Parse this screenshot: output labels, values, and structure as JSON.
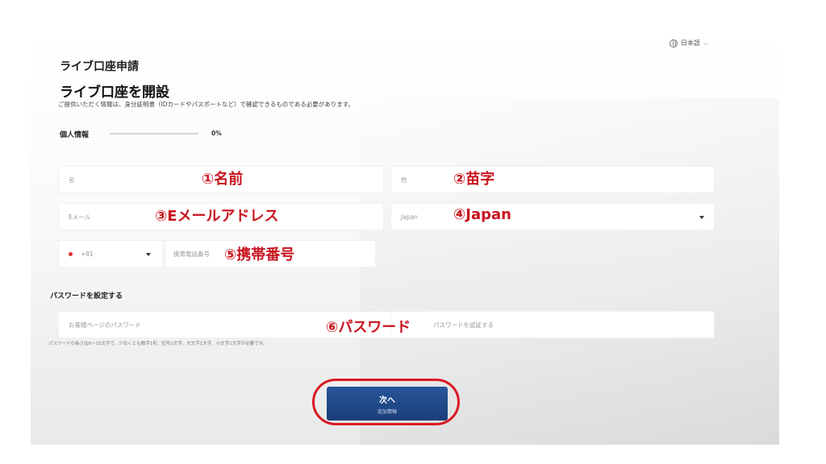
{
  "header": {
    "language": "日本語",
    "breadcrumb": "ライブ口座申請",
    "title": "ライブ口座を開設",
    "description": "ご提供いただく情報は、身分証明書（IDカードやパスポートなど）で確認できるものである必要があります。"
  },
  "personal": {
    "section_title": "個人情報",
    "progress_percent": "0%",
    "progress_value": 0
  },
  "fields": {
    "first_name": {
      "placeholder": "名",
      "annotation": "①名前"
    },
    "last_name": {
      "placeholder": "姓",
      "annotation": "②苗字"
    },
    "email": {
      "placeholder": "Eメール",
      "annotation": "③Eメールアドレス"
    },
    "country": {
      "value": "Japan",
      "annotation": "④Japan"
    },
    "phone_code": {
      "value": "+81"
    },
    "phone": {
      "placeholder": "携帯電話番号",
      "annotation": "⑤携帯番号"
    }
  },
  "password": {
    "section_title": "パスワードを設定する",
    "placeholder": "お客様ページのパスワード",
    "confirm_placeholder": "パスワードを認証する",
    "annotation": "⑥パスワード",
    "hint": "パスワードの長さは8～15文字で、少なくとも数字1桁、記号1文字、大文字1文字、小文字1文字が必要です。"
  },
  "next_button": {
    "label": "次へ",
    "sublabel": "追加情報"
  },
  "colors": {
    "accent": "#1b4f96",
    "annotation": "#c8141e"
  }
}
